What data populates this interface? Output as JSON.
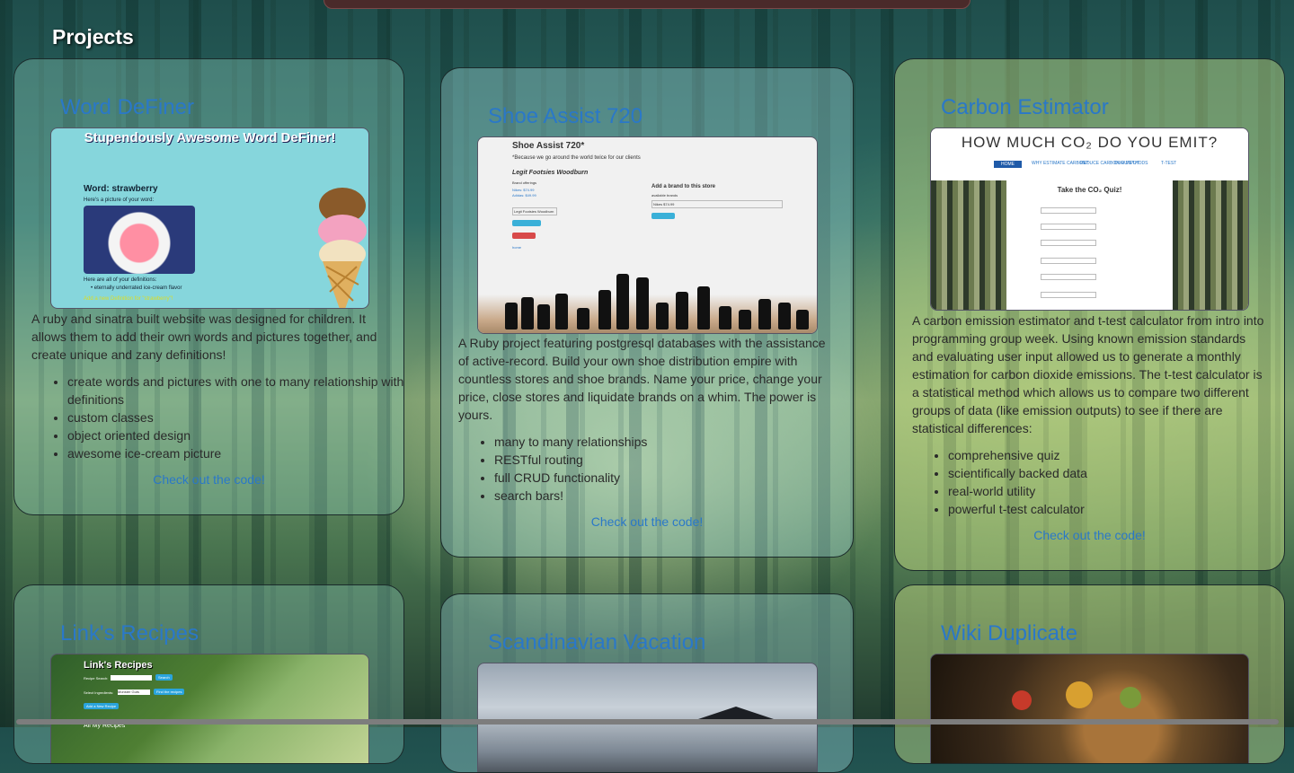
{
  "page": {
    "section_title": "Projects"
  },
  "projects": [
    {
      "title": "Word DeFiner",
      "description": "A ruby and sinatra built website was designed for children. It allows them to add their own words and pictures together, and create unique and zany definitions!",
      "features": [
        "create words and pictures with one to many relationship with definitions",
        "custom classes",
        "object oriented design",
        "awesome ice-cream picture"
      ],
      "link_label": "Check out the code!",
      "screenshot": {
        "heading": "Stupendously Awesome Word DeFiner!",
        "word_line": "Word: strawberry",
        "picture_caption": "Here's a picture of your word:",
        "definitions_caption": "Here are all of your definitions:",
        "definition_item": "• eternally underrated ice-cream flavor",
        "add_link": "Add a new Definition for \"strawberry\"!"
      }
    },
    {
      "title": "Shoe Assist 720",
      "description": "A Ruby project featuring postgresql databases with the assistance of active-record. Build your own shoe distribution empire with countless stores and shoe brands. Name your price, change your price, close stores and liquidate brands on a whim. The power is yours.",
      "features": [
        "many to many relationships",
        "RESTful routing",
        "full CRUD functionality",
        "search bars!"
      ],
      "link_label": "Check out the code!",
      "screenshot": {
        "heading": "Shoe Assist 720*",
        "tagline": "*Because we go around the world twice for our clients",
        "store": "Legit Footsies Woodburn",
        "brand_label": "Brand offerings",
        "brand_1": "Nikes: $74.99",
        "brand_2": "Adidas: $49.99",
        "field_value": "Legit Footsies Woodburn",
        "add_brand_title": "Add a brand to this store",
        "available_brands": "available brands",
        "select_value": "Nikes $74.99",
        "home_link": "home"
      }
    },
    {
      "title": "Carbon Estimator",
      "description": "A carbon emission estimator and t-test calculator from intro into programming group week. Using known emission standards and evaluating user input allowed us to generate a monthly estimation for carbon dioxide emissions. The t-test calculator is a statistical method which allows us to compare two different groups of data (like emission outputs) to see if there are statistical differences:",
      "features": [
        "comprehensive quiz",
        "scientifically backed data",
        "real-world utility",
        "powerful t-test calculator"
      ],
      "link_label": "Check out the code!",
      "screenshot": {
        "heading": "HOW MUCH CO₂ DO YOU EMIT?",
        "nav": [
          "HOME",
          "WHY ESTIMATE CARBON?",
          "REDUCE CARBON OUTPUT",
          "OUR METHODS",
          "T-TEST"
        ],
        "quiz_title": "Take the CO₂ Quiz!"
      }
    },
    {
      "title": "Link's Recipes",
      "screenshot": {
        "heading": "Link's Recipes",
        "search_label": "Recipe Search:",
        "search_btn": "Search",
        "ingredient_label": "Select Ingredients:",
        "ingredient_value": "Monster Guts",
        "find_btn": "Find the recipes",
        "add_btn": "Add a New Recipe",
        "all_label": "All My Recipes"
      }
    },
    {
      "title": "Scandinavian Vacation"
    },
    {
      "title": "Wiki Duplicate"
    }
  ],
  "colors": {
    "link": "#2a78c8",
    "title_text": "#ffffff"
  }
}
